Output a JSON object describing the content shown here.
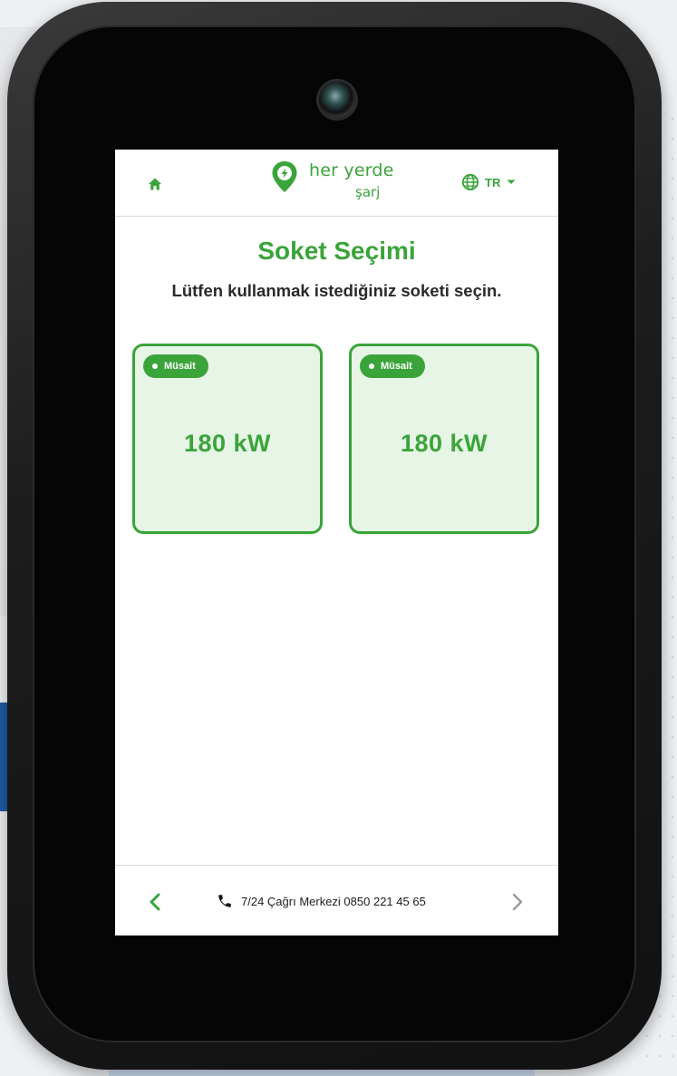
{
  "header": {
    "logo_text": "her yerde",
    "logo_subtext": "şarj",
    "language": "TR"
  },
  "page": {
    "title": "Soket Seçimi",
    "subtitle": "Lütfen kullanmak istediğiniz soketi seçin."
  },
  "sockets": [
    {
      "status": "Müsait",
      "power": "180 kW"
    },
    {
      "status": "Müsait",
      "power": "180 kW"
    }
  ],
  "footer": {
    "call_center": "7/24 Çağrı Merkezi 0850 221 45 65"
  },
  "colors": {
    "brand_green": "#3aa43a",
    "card_bg": "#e7f5e6"
  },
  "icons": [
    "home-icon",
    "logo-pin-icon",
    "globe-icon",
    "caret-down-icon",
    "chevron-left-icon",
    "phone-icon",
    "chevron-right-icon"
  ]
}
